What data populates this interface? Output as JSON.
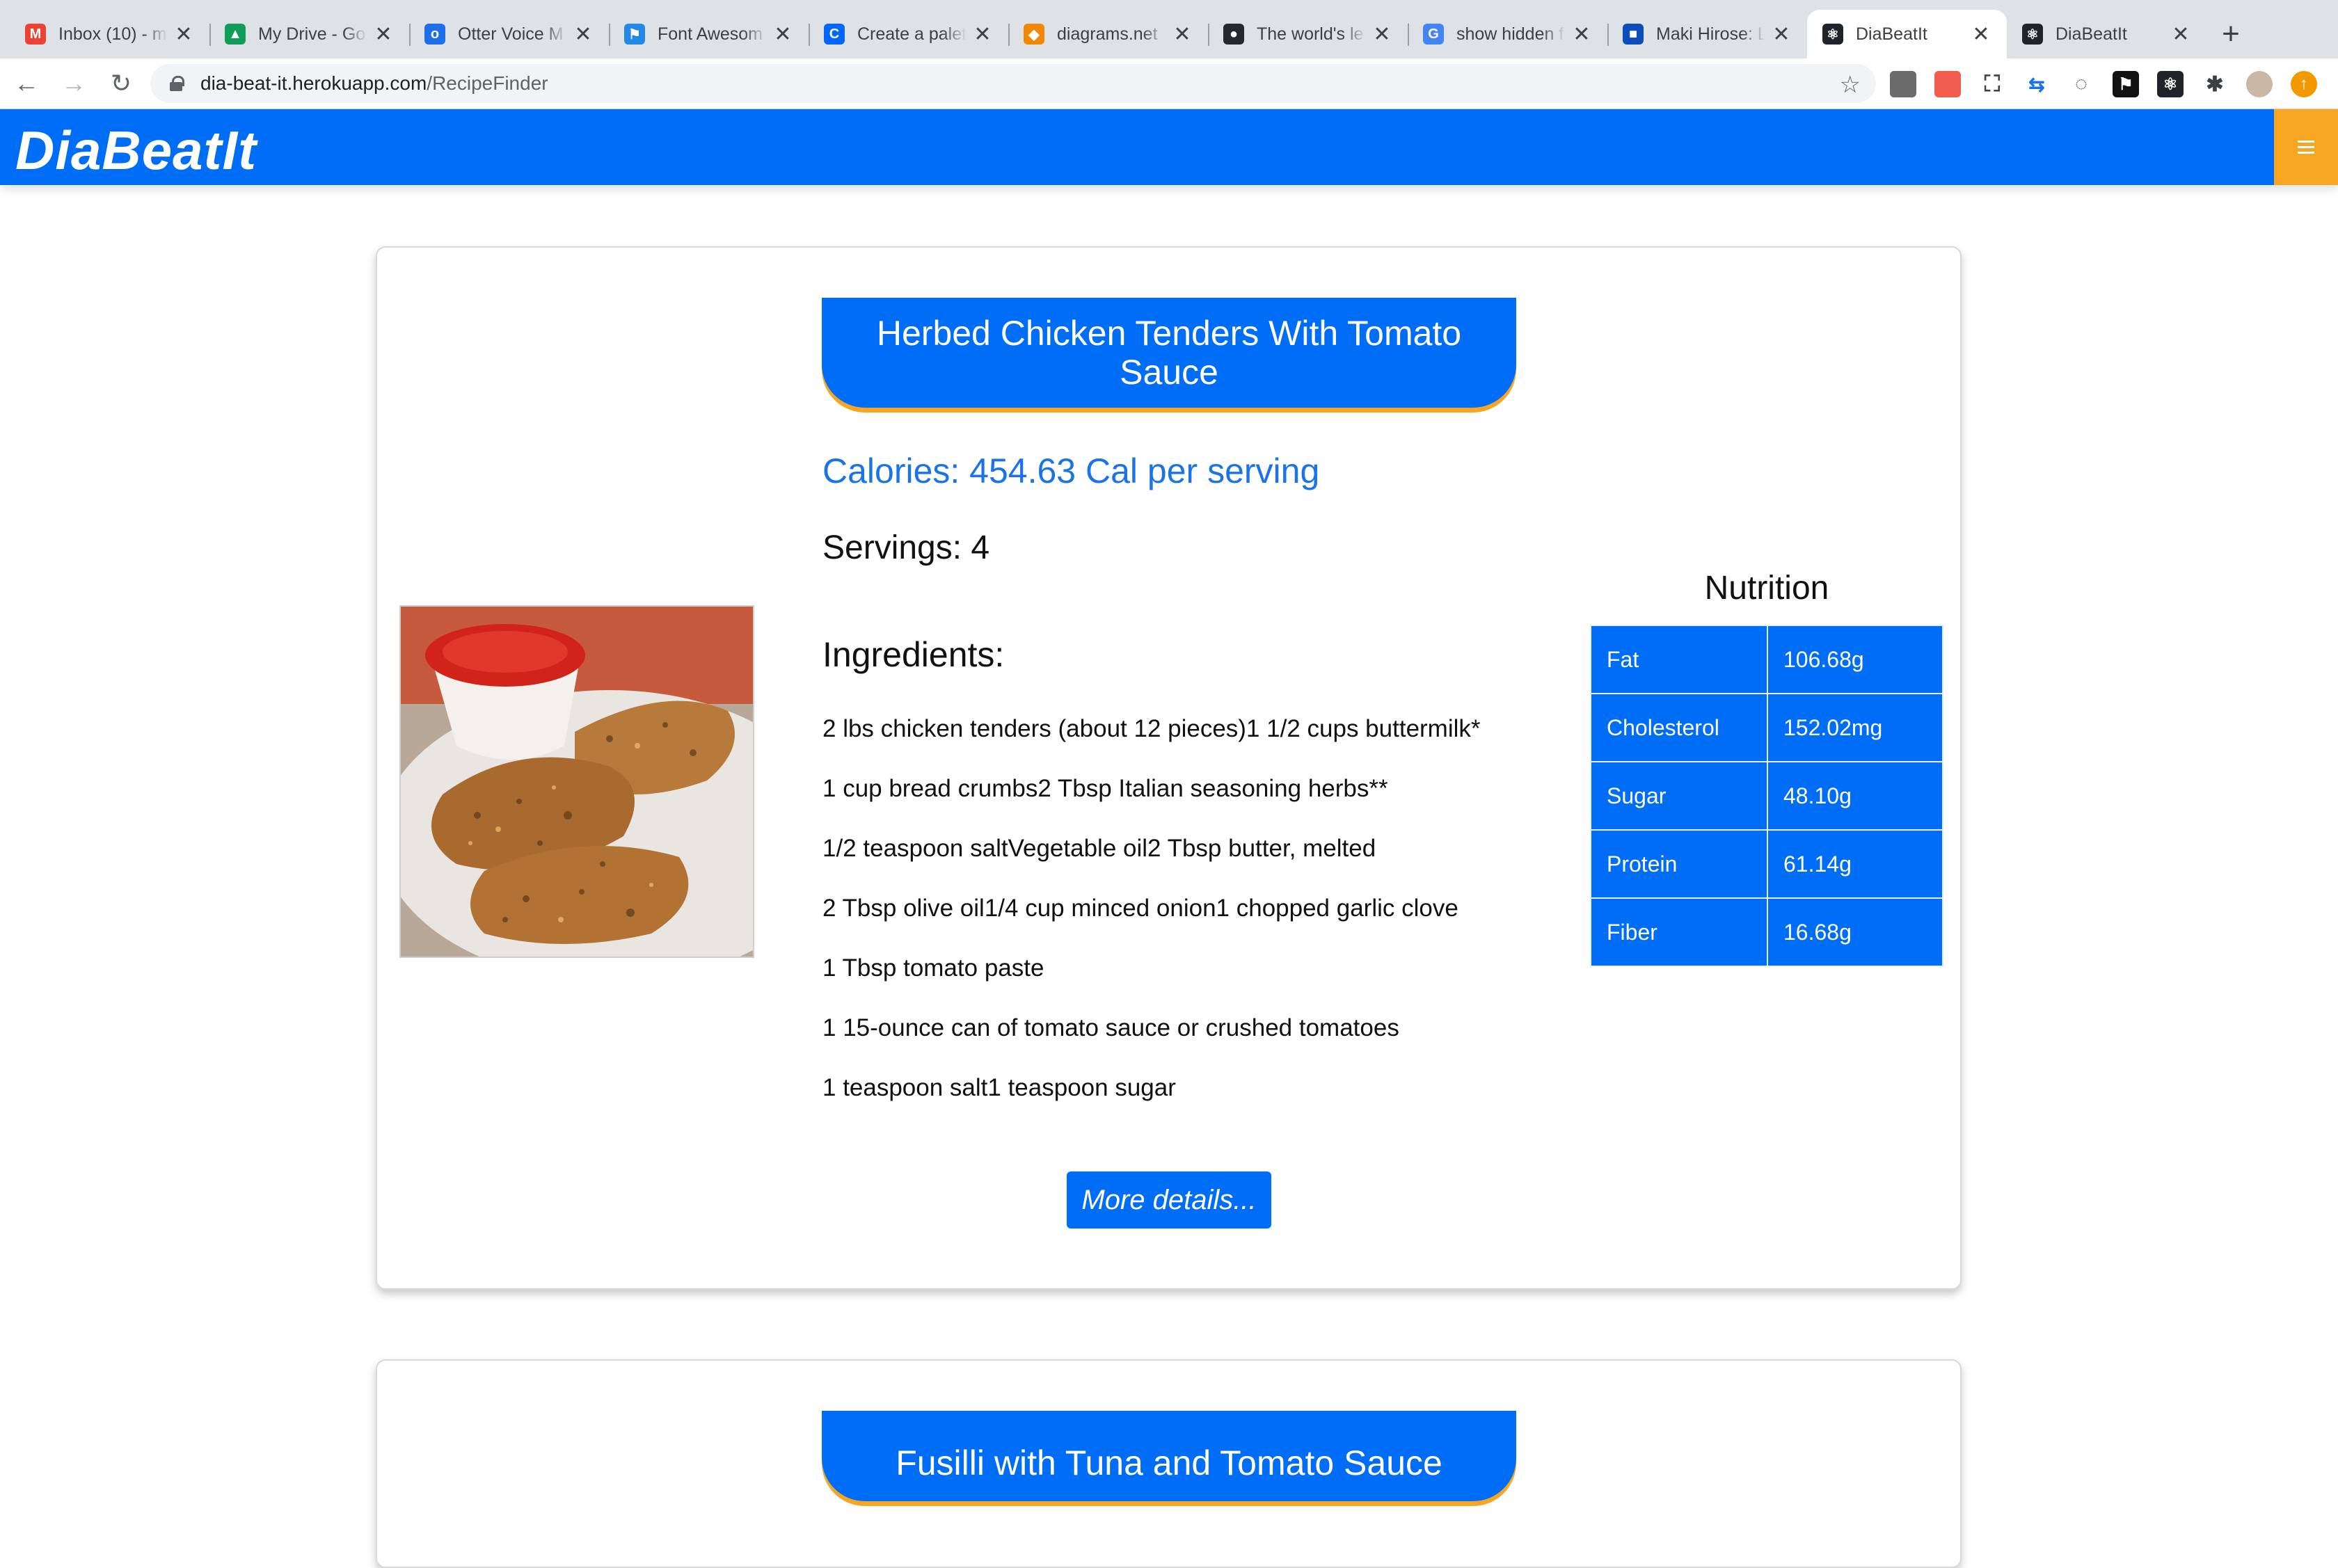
{
  "browser": {
    "tabs": [
      {
        "title": "Inbox (10) - m",
        "icon": "gmail-icon",
        "color": "#ea4335",
        "glyph": "M",
        "active": false
      },
      {
        "title": "My Drive - Go",
        "icon": "google-drive-icon",
        "color": "#0f9d58",
        "glyph": "▲",
        "active": false
      },
      {
        "title": "Otter Voice M",
        "icon": "otter-icon",
        "color": "#1f6fea",
        "glyph": "o",
        "active": false
      },
      {
        "title": "Font Awesom",
        "icon": "font-awesome-flag-icon",
        "color": "#228ae6",
        "glyph": "⚑",
        "active": false
      },
      {
        "title": "Create a palet",
        "icon": "coolors-icon",
        "color": "#0066ff",
        "glyph": "C",
        "active": false
      },
      {
        "title": "diagrams.net",
        "icon": "diagrams-icon",
        "color": "#f08705",
        "glyph": "◆",
        "active": false
      },
      {
        "title": "The world's le",
        "icon": "github-icon",
        "color": "#24292e",
        "glyph": "●",
        "active": false
      },
      {
        "title": "show hidden f",
        "icon": "google-icon",
        "color": "#4285f4",
        "glyph": "G",
        "active": false
      },
      {
        "title": "Maki Hirose: L",
        "icon": "trello-icon",
        "color": "#0c4dbb",
        "glyph": "■",
        "active": false
      },
      {
        "title": "DiaBeatIt",
        "icon": "react-icon",
        "color": "#20232a",
        "glyph": "⚛",
        "active": true
      },
      {
        "title": "DiaBeatIt",
        "icon": "react-icon",
        "color": "#20232a",
        "glyph": "⚛",
        "active": false
      }
    ],
    "close_glyph": "✕",
    "new_tab_glyph": "+",
    "back_glyph": "←",
    "forward_glyph": "→",
    "reload_glyph": "↻",
    "star_glyph": "☆",
    "url_host": "dia-beat-it.herokuapp.com",
    "url_path": "/RecipeFinder"
  },
  "app": {
    "brand": "DiaBeatIt",
    "accent_color": "#006df7",
    "secondary_color": "#f6a623"
  },
  "recipes": [
    {
      "title": "Herbed Chicken Tenders With Tomato Sauce",
      "calories": "Calories: 454.63 Cal per serving",
      "servings": "Servings: 4",
      "ingredients_heading": "Ingredients:",
      "ingredients": [
        "2 lbs chicken tenders (about 12 pieces)1 1/2 cups buttermilk*",
        "1 cup bread crumbs2 Tbsp Italian seasoning herbs**",
        "1/2 teaspoon saltVegetable oil2 Tbsp butter, melted",
        "2 Tbsp olive oil1/4 cup minced onion1 chopped garlic clove",
        "1 Tbsp tomato paste",
        "1 15-ounce can of tomato sauce or crushed tomatoes",
        "1 teaspoon salt1 teaspoon sugar"
      ],
      "nutrition_heading": "Nutrition",
      "nutrition": [
        {
          "label": "Fat",
          "value": "106.68g"
        },
        {
          "label": "Cholesterol",
          "value": "152.02mg"
        },
        {
          "label": "Sugar",
          "value": "48.10g"
        },
        {
          "label": "Protein",
          "value": "61.14g"
        },
        {
          "label": "Fiber",
          "value": "16.68g"
        }
      ],
      "more_button": "More details..."
    },
    {
      "title": "Fusilli with Tuna and Tomato Sauce"
    }
  ]
}
